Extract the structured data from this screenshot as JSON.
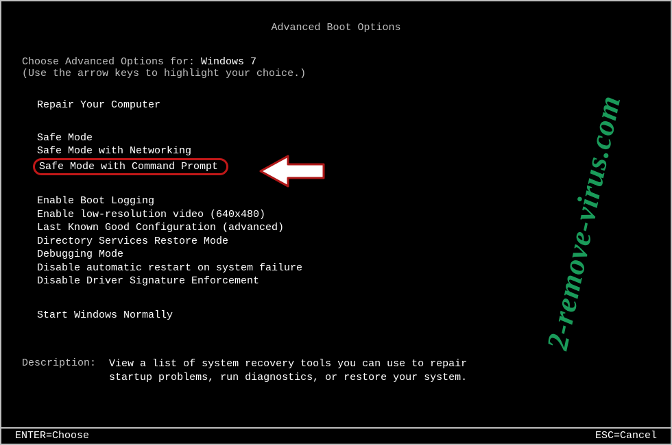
{
  "title": "Advanced Boot Options",
  "prompt_prefix": "Choose Advanced Options for: ",
  "os_name": "Windows 7",
  "instruction": "(Use the arrow keys to highlight your choice.)",
  "groups": {
    "g1": {
      "item0": "Repair Your Computer"
    },
    "g2": {
      "item0": "Safe Mode",
      "item1": "Safe Mode with Networking",
      "item2": "Safe Mode with Command Prompt"
    },
    "g3": {
      "item0": "Enable Boot Logging",
      "item1": "Enable low-resolution video (640x480)",
      "item2": "Last Known Good Configuration (advanced)",
      "item3": "Directory Services Restore Mode",
      "item4": "Debugging Mode",
      "item5": "Disable automatic restart on system failure",
      "item6": "Disable Driver Signature Enforcement"
    },
    "g4": {
      "item0": "Start Windows Normally"
    }
  },
  "description_label": "Description:",
  "description_text": "View a list of system recovery tools you can use to repair startup problems, run diagnostics, or restore your system.",
  "status": {
    "left": "ENTER=Choose",
    "right": "ESC=Cancel"
  },
  "watermark": "2-remove-virus.com",
  "colors": {
    "highlight_border": "#c01818",
    "watermark": "#1a9b5a"
  }
}
